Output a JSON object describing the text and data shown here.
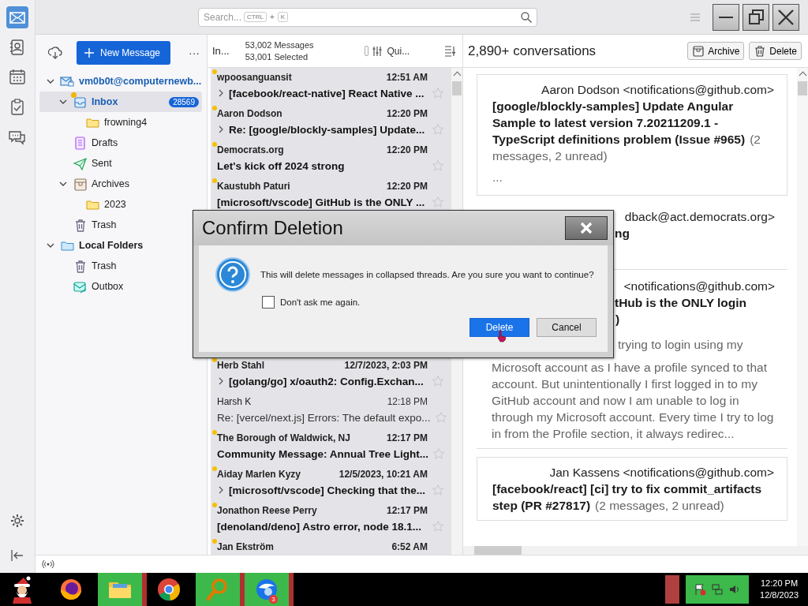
{
  "spaces": [
    {
      "kind": "mail",
      "selected": true
    },
    {
      "kind": "contacts",
      "selected": false
    },
    {
      "kind": "calendar",
      "selected": false
    },
    {
      "kind": "tasks",
      "selected": false
    },
    {
      "kind": "chat",
      "selected": false
    }
  ],
  "top_bar": {
    "search": {
      "placeholder": "Search...",
      "keys": [
        "CTRL",
        "+",
        "K"
      ]
    }
  },
  "folder_pane": {
    "new_message": "New Message",
    "more": "···",
    "folders": [
      {
        "name": "vm0b0t@computernewb...",
        "kind": "account",
        "expanded": true,
        "selected": false,
        "new_mail": false,
        "children": [
          {
            "name": "Inbox",
            "kind": "inbox",
            "count": "28569",
            "expanded": true,
            "selected": true,
            "new_mail": true,
            "children": [
              {
                "name": "frowning4",
                "kind": "folder",
                "selected": false,
                "new_mail": false
              }
            ]
          },
          {
            "name": "Drafts",
            "kind": "drafts",
            "selected": false,
            "new_mail": false
          },
          {
            "name": "Sent",
            "kind": "sent",
            "selected": false,
            "new_mail": false
          },
          {
            "name": "Archives",
            "kind": "archives",
            "expanded": true,
            "selected": false,
            "new_mail": false,
            "children": [
              {
                "name": "2023",
                "kind": "folder",
                "selected": false,
                "new_mail": false
              }
            ]
          },
          {
            "name": "Trash",
            "kind": "trash",
            "selected": false,
            "new_mail": false
          }
        ]
      },
      {
        "name": "Local Folders",
        "kind": "local",
        "expanded": true,
        "selected": false,
        "new_mail": false,
        "children": [
          {
            "name": "Trash",
            "kind": "trash",
            "selected": false,
            "new_mail": false
          },
          {
            "name": "Outbox",
            "kind": "outbox",
            "selected": false,
            "new_mail": false
          }
        ]
      }
    ]
  },
  "message_list": {
    "folder": "In...",
    "count": "53,002 Messages",
    "selected_count": "53,001 Selected",
    "view_toggle": {
      "on": false
    },
    "quick_filter": "Qui...",
    "rows": [
      {
        "sender": "wpoosanguansit",
        "date": "12:51 AM",
        "subject": "[facebook/react-native] React Native ...",
        "unread": true,
        "thread": true,
        "starred": false,
        "selected": true
      },
      {
        "sender": "Aaron Dodson",
        "date": "12:20 PM",
        "subject": "Re: [google/blockly-samples] Update...",
        "unread": true,
        "thread": true,
        "starred": false,
        "selected": true
      },
      {
        "sender": "Democrats.org",
        "date": "12:20 PM",
        "subject": "Let's kick off 2024 strong",
        "unread": true,
        "thread": false,
        "starred": false,
        "selected": true
      },
      {
        "sender": "Kaustubh Paturi",
        "date": "12:20 PM",
        "subject": "[microsoft/vscode] GitHub is the ONLY ...",
        "unread": true,
        "thread": false,
        "starred": false,
        "selected": true
      },
      {
        "sender": "Herb Stahl",
        "date": "12/7/2023, 2:03 PM",
        "subject": "[golang/go] x/oauth2: Config.Exchan...",
        "unread": true,
        "thread": true,
        "starred": false,
        "selected": true
      },
      {
        "sender": "Harsh K",
        "date": "12:18 PM",
        "subject": "Re: [vercel/next.js] Errors: The default expo...",
        "unread": false,
        "thread": false,
        "starred": false,
        "selected": true
      },
      {
        "sender": "The Borough of Waldwick, NJ",
        "date": "12:17 PM",
        "subject": "Community Message: Annual Tree Light...",
        "unread": true,
        "thread": false,
        "starred": false,
        "selected": true
      },
      {
        "sender": "Aiday Marlen Kyzy",
        "date": "12/5/2023, 10:21 AM",
        "subject": "[microsoft/vscode] Checking that the...",
        "unread": true,
        "thread": true,
        "starred": false,
        "selected": true
      },
      {
        "sender": "Jonathon Reese Perry",
        "date": "12:17 PM",
        "subject": "[denoland/deno] Astro error, node 18.1...",
        "unread": true,
        "thread": false,
        "starred": false,
        "selected": true
      },
      {
        "sender": "Jan Ekström",
        "date": "6:52 AM",
        "unread": true,
        "selected": true
      }
    ]
  },
  "reading_pane": {
    "title": "2,890+ conversations",
    "buttons": [
      "Archive",
      "Delete"
    ],
    "cards": [
      {
        "kind": "full",
        "from": "Aaron Dodson <notifications@github.com>",
        "subject": "[google/blockly-samples] Update Angular Sample to latest version 7.20211209.1 - TypeScript definitions problem (Issue #965)",
        "summary": "(2 messages, 2 unread)",
        "preview": "..."
      },
      {
        "kind": "partial",
        "from": "dback@act.democrats.org>",
        "subject": "ng"
      },
      {
        "kind": "partial",
        "from": "<notifications@github.com>",
        "subject": "tHub is the ONLY login",
        "subject_end": ")",
        "preview_start": "trying to login using my",
        "preview": "Microsoft account as I have a profile synced to that account. But unintentionally I first logged in to my GitHub account and now I am unable to log in through my Microsoft account. Every time I try to log in from the Profile section, it always redirec..."
      },
      {
        "kind": "full",
        "from": "Jan Kassens <notifications@github.com>",
        "subject": "[facebook/react] [ci] try to fix commit_artifacts step (PR #27817)",
        "summary": "(2 messages, 2 unread)"
      }
    ]
  },
  "dialog": {
    "title": "Confirm Deletion",
    "message": "This will delete messages in collapsed threads. Are you sure you want to continue?",
    "checkbox": {
      "label": "Don't ask me again.",
      "checked": false
    },
    "buttons": [
      {
        "label": "Delete",
        "default": true
      },
      {
        "label": "Cancel",
        "default": false
      }
    ]
  },
  "taskbar": {
    "apps": [
      {
        "kind": "santa",
        "running": false
      },
      {
        "kind": "firefox",
        "running": false
      },
      {
        "kind": "explorer",
        "running": true
      },
      {
        "kind": "chrome",
        "running": false
      },
      {
        "kind": "search",
        "running": true
      },
      {
        "kind": "thunderbird",
        "running": true,
        "badge": "3"
      }
    ],
    "time": "12:20 PM",
    "date": "12/8/2023"
  }
}
